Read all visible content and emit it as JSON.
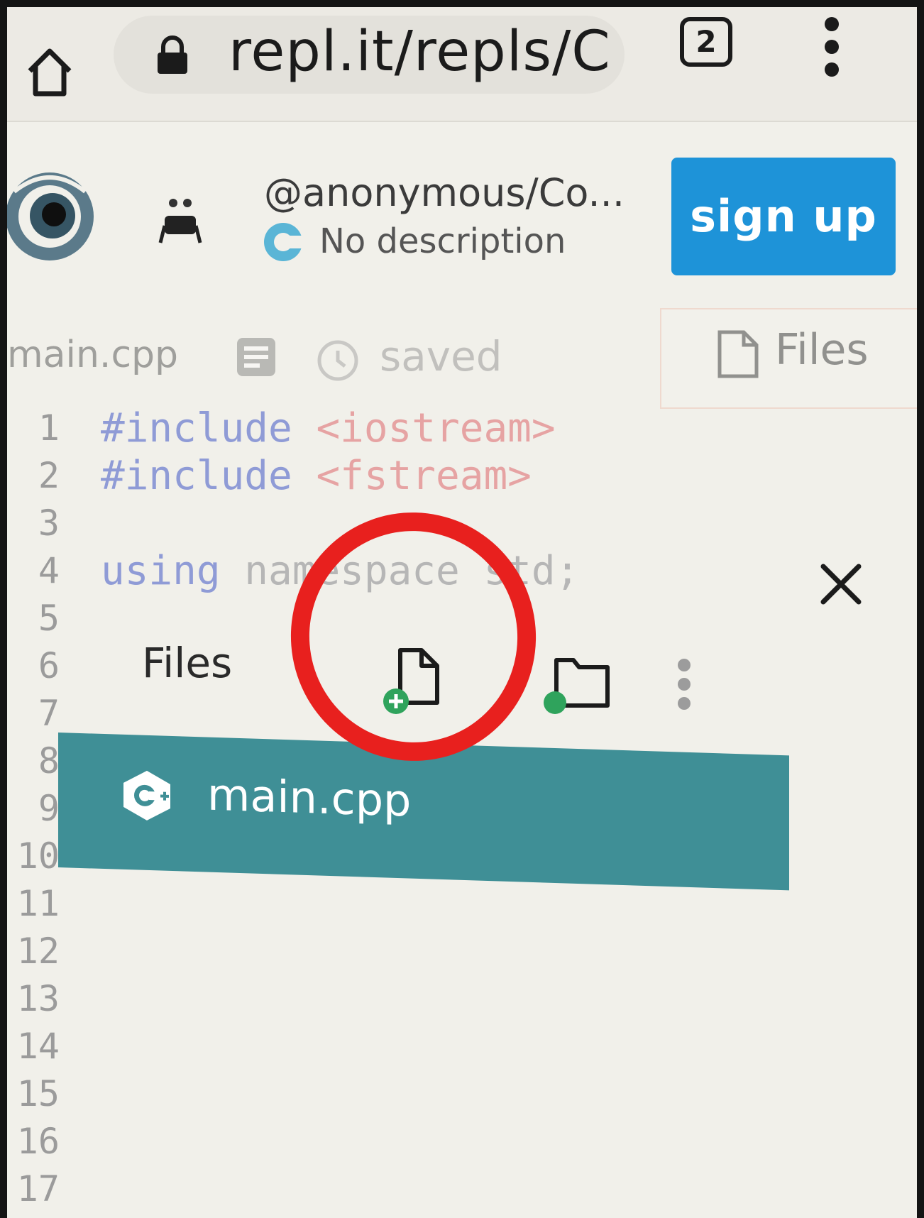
{
  "browser": {
    "url": "repl.it/repls/C",
    "tab_count": "2",
    "icons": [
      "home-icon",
      "lock-icon",
      "tabs-icon",
      "menu-icon"
    ]
  },
  "header": {
    "title": "@anonymous/Co...",
    "description": "No description",
    "signup_label": "sign up",
    "brand_color": "#1e93d8"
  },
  "editor": {
    "file_name": "main.cpp",
    "status": "saved",
    "files_tab_label": "Files",
    "line_numbers": [
      "1",
      "2",
      "3",
      "4",
      "5",
      "6",
      "7",
      "8",
      "9",
      "10",
      "11",
      "12",
      "13",
      "14",
      "15",
      "16",
      "17"
    ],
    "code": {
      "line1_kw": "#include",
      "line1_str": "<iostream>",
      "line2_kw": "#include",
      "line2_str": "<fstream>",
      "line4_kw": "using",
      "line4_rest": "namespace std;"
    }
  },
  "files_panel": {
    "title": "Files",
    "close_icon": "close-icon",
    "new_file_icon": "new-file-icon",
    "new_folder_icon": "new-folder-icon",
    "files": [
      {
        "name": "main.cpp",
        "icon": "cpp-icon"
      }
    ],
    "selected_color": "#3f8f96",
    "annotation_color": "#e8201e"
  }
}
